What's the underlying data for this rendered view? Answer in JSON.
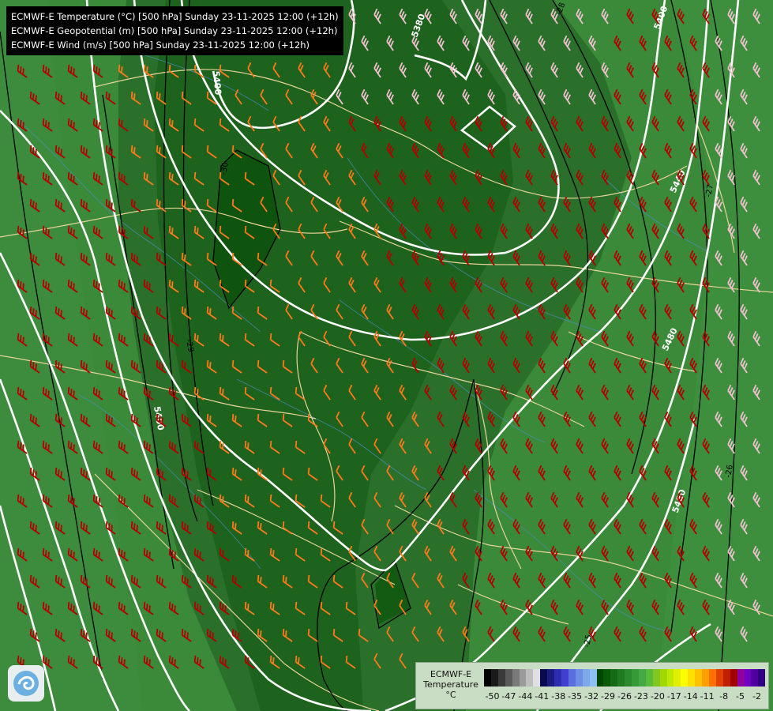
{
  "map": {
    "titles": [
      "ECMWF-E Temperature (°C) [500 hPa] Sunday 23-11-2025 12:00 (+12h)",
      "ECMWF-E Geopotential (m) [500 hPa] Sunday 23-11-2025 12:00 (+12h)",
      "ECMWF-E Wind (m/s) [500 hPa] Sunday 23-11-2025 12:00 (+12h)"
    ],
    "geopotential_labels": [
      "5380",
      "5400",
      "5440",
      "5480",
      "5400",
      "5400",
      "5480"
    ],
    "temperature_labels": [
      "-30",
      "-29",
      "-27",
      "-26",
      "-25",
      "-28",
      "-27"
    ],
    "colors": {
      "background": "#2f7a2f",
      "cold_core": "#0f5a0f",
      "mid": "#1f6a1f",
      "geopotential": "#ffffff",
      "isotherm": "#000000",
      "borders": "#e8d59a",
      "rivers": "#4a8fc4",
      "wind_weak": "#ff7a1a",
      "wind_strong": "#b00000",
      "wind_light": "#f0c0d0"
    }
  },
  "legend": {
    "title_lines": [
      "ECMWF-E",
      "Temperature",
      "°C"
    ],
    "ticks": [
      "-50",
      "-47",
      "-44",
      "-41",
      "-38",
      "-35",
      "-32",
      "-29",
      "-26",
      "-23",
      "-20",
      "-17",
      "-14",
      "-11",
      "-8",
      "-5",
      "-2"
    ],
    "colors": [
      "#000000",
      "#1a1a1a",
      "#3a3a3a",
      "#5a5a5a",
      "#7a7a7a",
      "#9a9a9a",
      "#bdbdbd",
      "#e0e0e0",
      "#0a0a50",
      "#1b1b80",
      "#2d2db0",
      "#4040d0",
      "#5a6ee0",
      "#6c8ee6",
      "#7ea8ea",
      "#8ec0f0",
      "#004800",
      "#0a5a0a",
      "#156a15",
      "#207a20",
      "#2b8a2b",
      "#369a36",
      "#45aa45",
      "#5aba3a",
      "#80c820",
      "#a0d800",
      "#c0e800",
      "#e0f000",
      "#ffff00",
      "#ffe000",
      "#ffc000",
      "#ffa000",
      "#ff7000",
      "#e04000",
      "#c02000",
      "#a00000",
      "#9000a0",
      "#7000c0",
      "#5000a0",
      "#300080"
    ]
  },
  "logo": {
    "icon": "weather-service-logo-icon"
  }
}
